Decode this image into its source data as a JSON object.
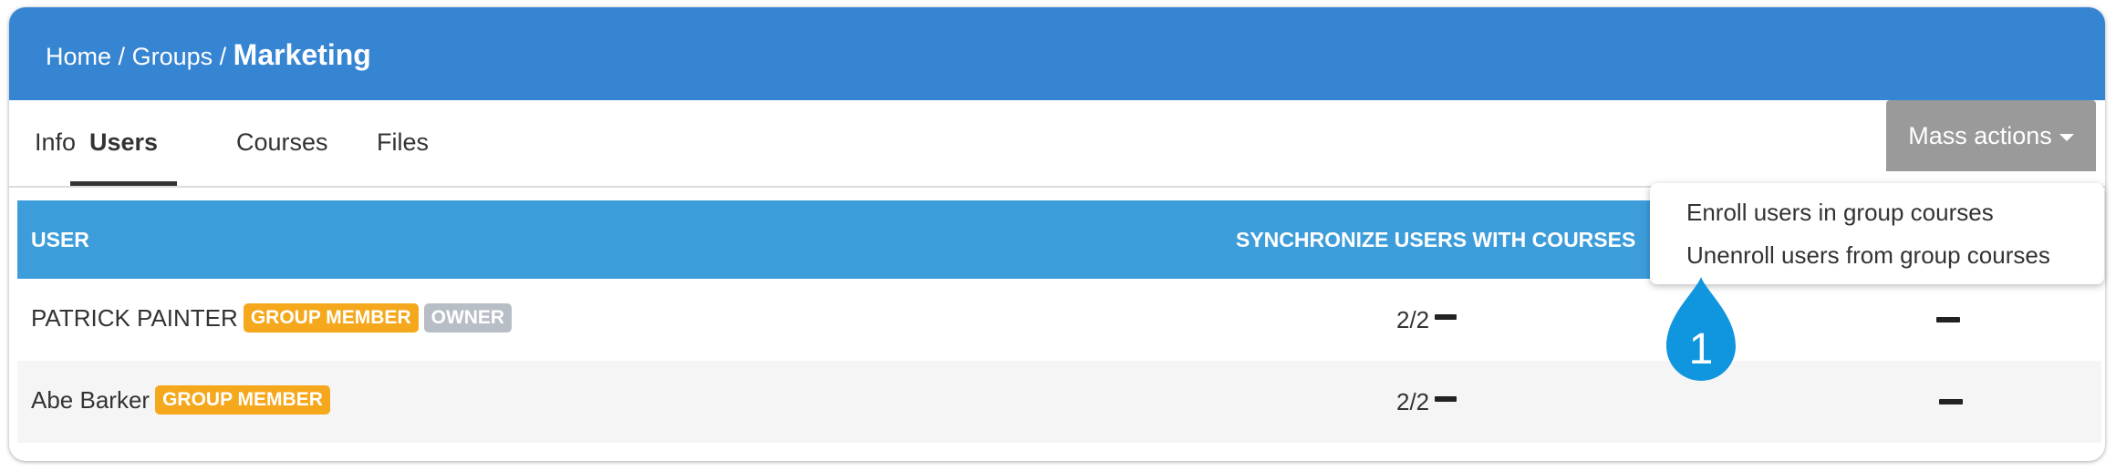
{
  "breadcrumb": {
    "home": "Home",
    "sep1": "/",
    "groups": "Groups",
    "sep2": "/",
    "current": "Marketing"
  },
  "tabs": [
    {
      "label": "Info",
      "active": false
    },
    {
      "label": "Users",
      "active": true
    },
    {
      "label": "Courses",
      "active": false
    },
    {
      "label": "Files",
      "active": false
    }
  ],
  "mass_actions": {
    "label": "Mass actions",
    "items": [
      "Enroll users in group courses",
      "Unenroll users from group courses"
    ]
  },
  "table": {
    "headers": {
      "user": "USER",
      "sync": "SYNCHRONIZE USERS WITH COURSES"
    },
    "rows": [
      {
        "name": "PATRICK PAINTER",
        "badges": [
          "GROUP MEMBER",
          "OWNER"
        ],
        "sync": "2/2"
      },
      {
        "name": "Abe Barker",
        "badges": [
          "GROUP MEMBER"
        ],
        "sync": "2/2"
      }
    ]
  },
  "callout": {
    "number": "1"
  },
  "colors": {
    "header_bg": "#3585d3",
    "table_header_bg": "#3d9ddb",
    "member_badge": "#f5a81c",
    "owner_badge": "#b8bec6",
    "mass_actions_bg": "#9a9a9a",
    "callout": "#0f96de"
  }
}
